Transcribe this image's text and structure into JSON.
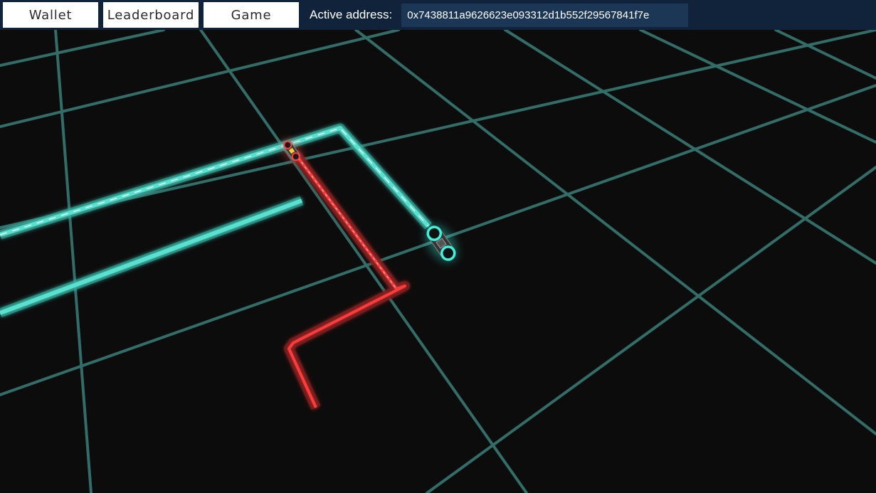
{
  "toolbar": {
    "wallet_label": "Wallet",
    "leaderboard_label": "Leaderboard",
    "game_label": "Game",
    "address_label": "Active address:",
    "address_value": "0x7438811a9626623e093312d1b552f29567841f7e"
  },
  "colors": {
    "topbar_bg": "#10233a",
    "address_field_bg": "#1c3656",
    "grid": "#3a7e78",
    "cyan_trail": "#4fd8c8",
    "red_trail": "#ff3030",
    "floor": "#0c0c0c"
  },
  "scene": {
    "players": [
      {
        "name_icon": "cyan-lightcycle-icon",
        "trail_color": "cyan"
      },
      {
        "name_icon": "red-lightcycle-icon",
        "trail_color": "red"
      }
    ]
  }
}
